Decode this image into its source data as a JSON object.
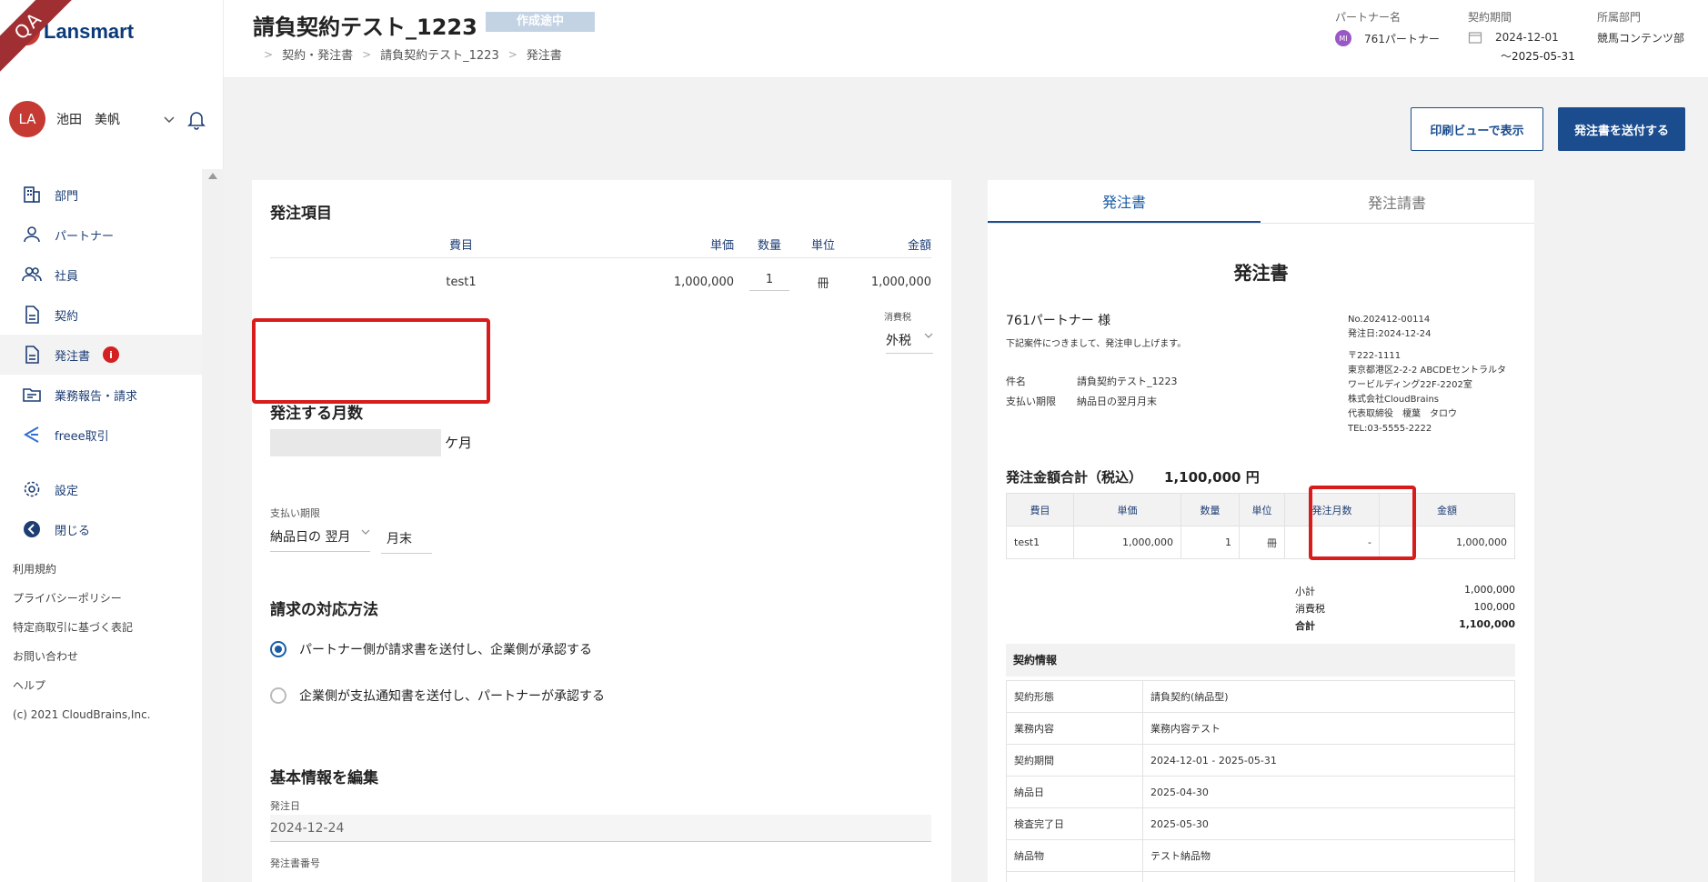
{
  "sidebar": {
    "ribbon": "QA",
    "logo": "Lansmart",
    "user": {
      "initials": "LA",
      "name": "池田　美帆"
    },
    "nav": [
      {
        "label": "部門"
      },
      {
        "label": "パートナー"
      },
      {
        "label": "社員"
      },
      {
        "label": "契約"
      },
      {
        "label": "発注書",
        "badge": "i"
      },
      {
        "label": "業務報告・請求"
      },
      {
        "label": "freee取引"
      }
    ],
    "nav_bottom": [
      {
        "label": "設定"
      },
      {
        "label": "閉じる"
      }
    ],
    "footer": [
      "利用規約",
      "プライバシーポリシー",
      "特定商取引に基づく表記",
      "お問い合わせ",
      "ヘルプ",
      "(c) 2021 CloudBrains,Inc."
    ]
  },
  "header": {
    "title": "請負契約テスト_1223",
    "status": "作成途中",
    "breadcrumb": [
      "契約・発注書",
      "請負契約テスト_1223",
      "発注書"
    ],
    "partner_label": "パートナー名",
    "partner_initials": "MI",
    "partner_name": "761パートナー",
    "period_label": "契約期間",
    "period_start": "2024-12-01",
    "period_end": "～2025-05-31",
    "dept_label": "所属部門",
    "dept_name": "競馬コンテンツ部"
  },
  "actions": {
    "print": "印刷ビューで表示",
    "send": "発注書を送付する"
  },
  "form": {
    "items_title": "発注項目",
    "columns": [
      "費目",
      "単価",
      "数量",
      "単位",
      "金額"
    ],
    "rows": [
      {
        "name": "test1",
        "price": "1,000,000",
        "qty": "1",
        "unit": "冊",
        "amount": "1,000,000"
      }
    ],
    "tax_label": "消費税",
    "tax_value": "外税",
    "months_title": "発注する月数",
    "months_unit": "ケ月",
    "pay_label": "支払い期限",
    "pay_month": "納品日の 翌月",
    "pay_day": "月末",
    "billing_title": "請求の対応方法",
    "billing_options": [
      "パートナー側が請求書を送付し、企業側が承認する",
      "企業側が支払通知書を送付し、パートナーが承認する"
    ],
    "basic_title": "基本情報を編集",
    "order_date_label": "発注日",
    "order_date": "2024-12-24",
    "order_no_label": "発注書番号"
  },
  "preview": {
    "tabs": [
      "発注書",
      "発注請書"
    ],
    "title": "発注書",
    "to": "761パートナー 様",
    "intro": "下記案件につきまして、発注申し上げます。",
    "no": "No.202412-00114",
    "date": "発注日:2024-12-24",
    "zip": "〒222-1111",
    "addr1": "東京都港区2-2-2 ABCDEセントラルタ",
    "addr2": "ワービルディング22F-2202室",
    "company": "株式会社CloudBrains",
    "rep": "代表取締役　榎葉　タロウ",
    "tel": "TEL:03-5555-2222",
    "subject_label": "件名",
    "subject": "請負契約テスト_1223",
    "due_label": "支払い期限",
    "due": "納品日の翌月月末",
    "total_label": "発注金額合計（税込）",
    "total": "1,100,000 円",
    "columns": [
      "費目",
      "単価",
      "数量",
      "単位",
      "発注月数",
      "金額"
    ],
    "row": {
      "name": "test1",
      "price": "1,000,000",
      "qty": "1",
      "unit": "冊",
      "months": "-",
      "amount": "1,000,000"
    },
    "subtotal_label": "小計",
    "subtotal": "1,000,000",
    "tax_label": "消費税",
    "tax": "100,000",
    "sum_label": "合計",
    "sum": "1,100,000",
    "info_title": "契約情報",
    "info": [
      {
        "k": "契約形態",
        "v": "請負契約(納品型)"
      },
      {
        "k": "業務内容",
        "v": "業務内容テスト"
      },
      {
        "k": "契約期間",
        "v": "2024-12-01 - 2025-05-31"
      },
      {
        "k": "納品日",
        "v": "2025-04-30"
      },
      {
        "k": "検査完了日",
        "v": "2025-05-30"
      },
      {
        "k": "納品物",
        "v": "テスト納品物"
      },
      {
        "k": "",
        "v": ""
      }
    ]
  }
}
